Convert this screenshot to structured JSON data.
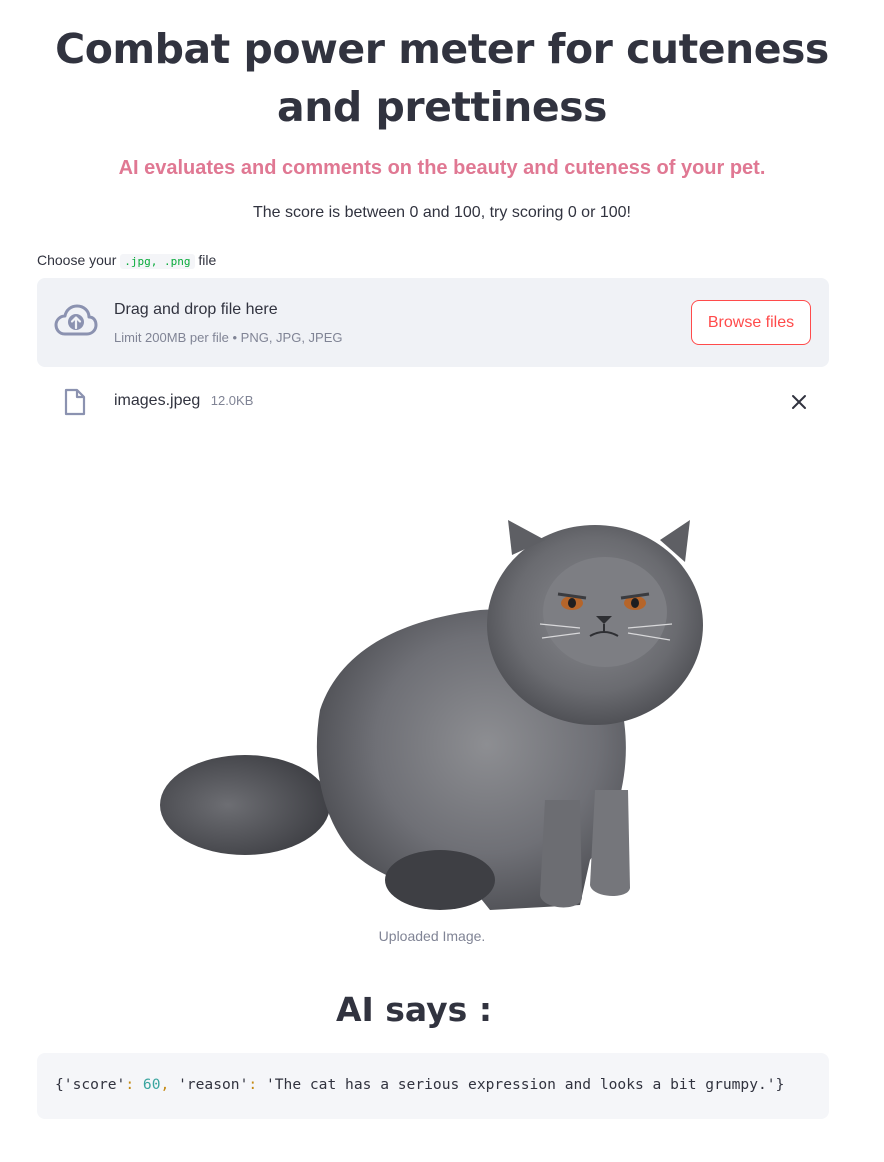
{
  "header": {
    "title": "Combat power meter for cuteness and prettiness",
    "subtitle": "AI evaluates and comments on the beauty and cuteness of your pet.",
    "note": "The score is between 0 and 100, try scoring 0 or 100!"
  },
  "uploader": {
    "label_prefix": "Choose your",
    "label_types": ".jpg, .png",
    "label_suffix": "file",
    "drop_title": "Drag and drop file here",
    "drop_limit": "Limit 200MB per file • PNG, JPG, JPEG",
    "browse_label": "Browse files",
    "icon": "cloud-upload-icon"
  },
  "uploaded_file": {
    "name": "images.jpeg",
    "size": "12.0KB",
    "icon": "file-icon",
    "remove_icon": "close-icon"
  },
  "image": {
    "caption": "Uploaded Image."
  },
  "result": {
    "heading": "AI says :",
    "code": {
      "open": "{",
      "key1": "'score'",
      "colon": ":",
      "value1": "60",
      "comma": ",",
      "key2": "'reason'",
      "value2": "'The cat has a serious expression and looks a bit grumpy.'",
      "close": "}"
    }
  },
  "colors": {
    "accent": "#ff4b4b",
    "subtitle": "#e07893",
    "text": "#31333f",
    "muted": "#808495",
    "dropzone_bg": "#f0f2f6"
  }
}
